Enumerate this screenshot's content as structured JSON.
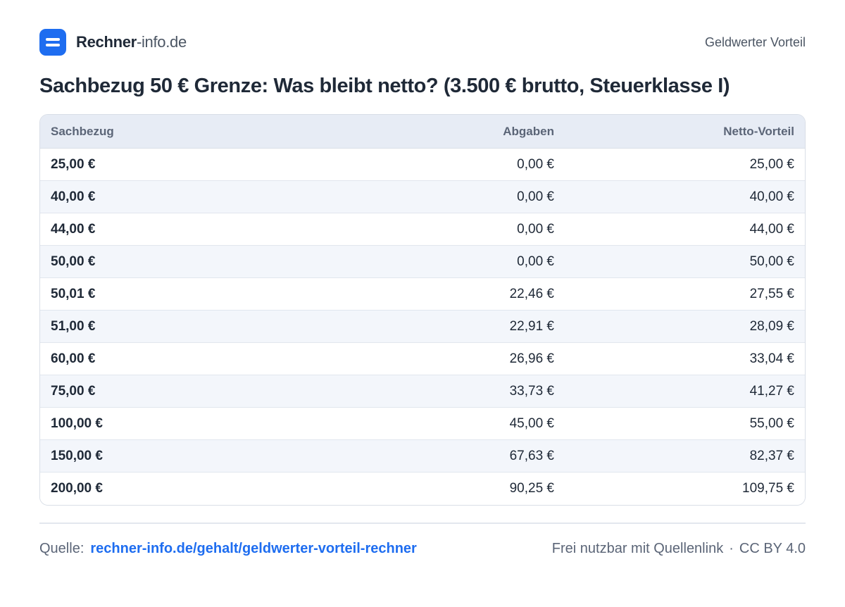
{
  "header": {
    "brand_bold": "Rechner",
    "brand_light": "-info.de",
    "section": "Geldwerter Vorteil",
    "logo_icon": "equals-icon",
    "accent_color": "#1e6df0"
  },
  "title": "Sachbezug 50 € Grenze: Was bleibt netto? (3.500 € brutto, Steuerklasse I)",
  "table": {
    "headers": [
      "Sachbezug",
      "Abgaben",
      "Netto-Vorteil"
    ],
    "rows": [
      [
        "25,00 €",
        "0,00 €",
        "25,00 €"
      ],
      [
        "40,00 €",
        "0,00 €",
        "40,00 €"
      ],
      [
        "44,00 €",
        "0,00 €",
        "44,00 €"
      ],
      [
        "50,00 €",
        "0,00 €",
        "50,00 €"
      ],
      [
        "50,01 €",
        "22,46 €",
        "27,55 €"
      ],
      [
        "51,00 €",
        "22,91 €",
        "28,09 €"
      ],
      [
        "60,00 €",
        "26,96 €",
        "33,04 €"
      ],
      [
        "75,00 €",
        "33,73 €",
        "41,27 €"
      ],
      [
        "100,00 €",
        "45,00 €",
        "55,00 €"
      ],
      [
        "150,00 €",
        "67,63 €",
        "82,37 €"
      ],
      [
        "200,00 €",
        "90,25 €",
        "109,75 €"
      ]
    ]
  },
  "footer": {
    "source_label": "Quelle:",
    "source_link": "rechner-info.de/gehalt/geldwerter-vorteil-rechner",
    "license_text": "Frei nutzbar mit Quellenlink",
    "separator": "·",
    "license": "CC BY 4.0"
  }
}
